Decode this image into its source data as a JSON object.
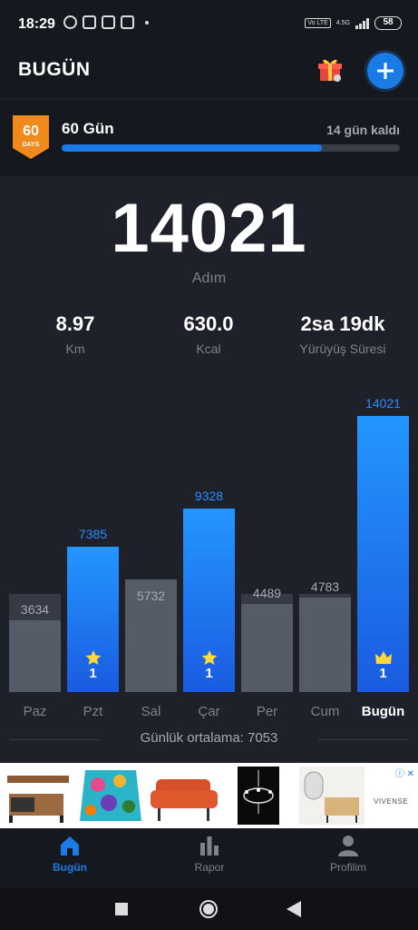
{
  "status_bar": {
    "time": "18:29",
    "network": "4.5G",
    "volte": "Vo LTE",
    "battery": "58"
  },
  "header": {
    "title": "BUGÜN",
    "gift_icon": "gift-icon",
    "add_icon": "plus-icon"
  },
  "challenge": {
    "badge_number": "60",
    "badge_sub": "DAYS",
    "name": "60 Gün",
    "remaining": "14 gün kaldı",
    "progress": 0.77
  },
  "stats": {
    "steps": "14021",
    "steps_label": "Adım",
    "distance": {
      "value": "8.97",
      "label": "Km"
    },
    "calories": {
      "value": "630.0",
      "label": "Kcal"
    },
    "duration": {
      "value": "2sa 19dk",
      "label": "Yürüyüş Süresi"
    }
  },
  "chart_data": {
    "type": "bar",
    "categories": [
      "Paz",
      "Pzt",
      "Sal",
      "Çar",
      "Per",
      "Cum",
      "Bugün"
    ],
    "values": [
      3634,
      7385,
      5732,
      9328,
      4489,
      4783,
      14021
    ],
    "labels": [
      "3634",
      "7385",
      "5732",
      "9328",
      "4489",
      "4783",
      "14021"
    ],
    "goal_reached": [
      false,
      true,
      false,
      true,
      false,
      false,
      true
    ],
    "goal_marks": [
      "",
      "1",
      "",
      "1",
      "",
      "",
      "1"
    ],
    "goal_icons": [
      "",
      "star-icon",
      "",
      "star-icon",
      "",
      "",
      "crown-icon"
    ],
    "goal": 5000,
    "ylim": [
      0,
      14021
    ],
    "colors": {
      "highlight": "#1a7be6",
      "normal": "#565b68"
    }
  },
  "average": {
    "text": "Günlük ortalama: 7053"
  },
  "ad": {
    "brand": "VIVENSE"
  },
  "nav": {
    "items": [
      {
        "label": "Bugün",
        "icon": "home-icon",
        "active": true
      },
      {
        "label": "Rapor",
        "icon": "bar-chart-icon",
        "active": false
      },
      {
        "label": "Profilim",
        "icon": "person-icon",
        "active": false
      }
    ]
  },
  "accent": "#1a7be6"
}
